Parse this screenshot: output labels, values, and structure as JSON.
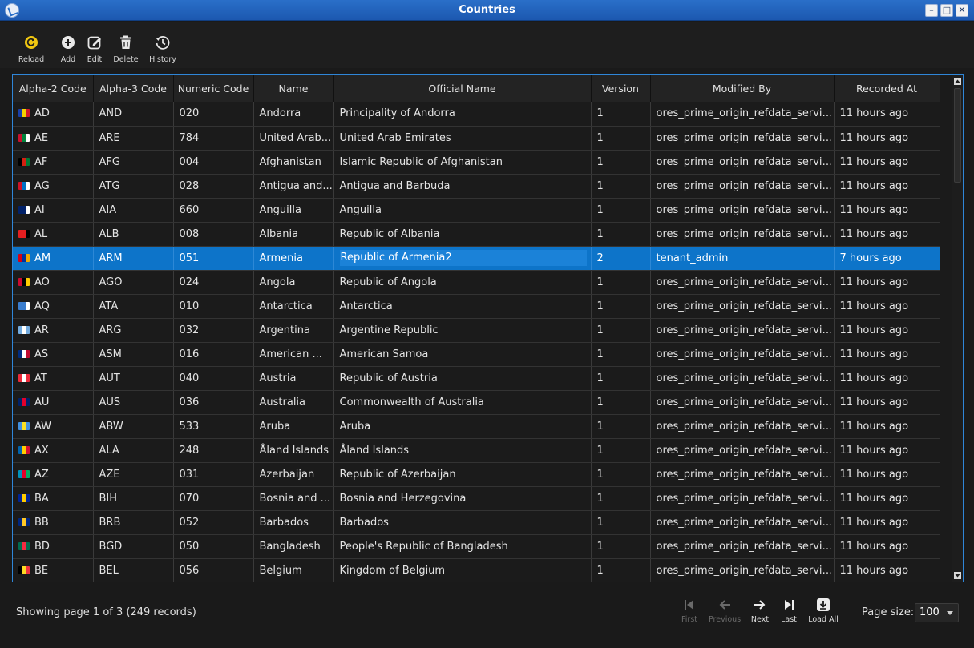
{
  "window": {
    "title": "Countries"
  },
  "toolbar": {
    "reload": "Reload",
    "add": "Add",
    "edit": "Edit",
    "delete": "Delete",
    "history": "History"
  },
  "table": {
    "columns": [
      "Alpha-2 Code",
      "Alpha-3 Code",
      "Numeric Code",
      "Name",
      "Official Name",
      "Version",
      "Modified By",
      "Recorded At"
    ],
    "rows": [
      {
        "a2": "AD",
        "a3": "AND",
        "num": "020",
        "name": "Andorra",
        "official": "Principality of Andorra",
        "ver": "1",
        "by": "ores_prime_origin_refdata_service",
        "at": "11 hours ago",
        "flag": [
          "#1a3fa8",
          "#f4d300",
          "#d11a2a"
        ]
      },
      {
        "a2": "AE",
        "a3": "ARE",
        "num": "784",
        "name": "United Arab...",
        "official": "United Arab Emirates",
        "ver": "1",
        "by": "ores_prime_origin_refdata_service",
        "at": "11 hours ago",
        "flag": [
          "#c8102e",
          "#00843d",
          "#ffffff"
        ]
      },
      {
        "a2": "AF",
        "a3": "AFG",
        "num": "004",
        "name": "Afghanistan",
        "official": "Islamic Republic of Afghanistan",
        "ver": "1",
        "by": "ores_prime_origin_refdata_service",
        "at": "11 hours ago",
        "flag": [
          "#000000",
          "#d32011",
          "#007a36"
        ]
      },
      {
        "a2": "AG",
        "a3": "ATG",
        "num": "028",
        "name": "Antigua and...",
        "official": "Antigua and Barbuda",
        "ver": "1",
        "by": "ores_prime_origin_refdata_service",
        "at": "11 hours ago",
        "flag": [
          "#ce1126",
          "#0072c6",
          "#ffffff"
        ]
      },
      {
        "a2": "AI",
        "a3": "AIA",
        "num": "660",
        "name": "Anguilla",
        "official": "Anguilla",
        "ver": "1",
        "by": "ores_prime_origin_refdata_service",
        "at": "11 hours ago",
        "flag": [
          "#012169",
          "#012169",
          "#ffffff"
        ]
      },
      {
        "a2": "AL",
        "a3": "ALB",
        "num": "008",
        "name": "Albania",
        "official": "Republic of Albania",
        "ver": "1",
        "by": "ores_prime_origin_refdata_service",
        "at": "11 hours ago",
        "flag": [
          "#e41e20",
          "#e41e20",
          "#000000"
        ]
      },
      {
        "a2": "AM",
        "a3": "ARM",
        "num": "051",
        "name": "Armenia",
        "official": "Republic of Armenia2",
        "ver": "2",
        "by": "tenant_admin",
        "at": "7 hours ago",
        "flag": [
          "#d90012",
          "#0033a0",
          "#f2a800"
        ],
        "selected": true
      },
      {
        "a2": "AO",
        "a3": "AGO",
        "num": "024",
        "name": "Angola",
        "official": "Republic of Angola",
        "ver": "1",
        "by": "ores_prime_origin_refdata_service",
        "at": "11 hours ago",
        "flag": [
          "#cc092f",
          "#000000",
          "#ffcb00"
        ]
      },
      {
        "a2": "AQ",
        "a3": "ATA",
        "num": "010",
        "name": "Antarctica",
        "official": "Antarctica",
        "ver": "1",
        "by": "ores_prime_origin_refdata_service",
        "at": "11 hours ago",
        "flag": [
          "#3a7dce",
          "#3a7dce",
          "#ffffff"
        ]
      },
      {
        "a2": "AR",
        "a3": "ARG",
        "num": "032",
        "name": "Argentina",
        "official": "Argentine Republic",
        "ver": "1",
        "by": "ores_prime_origin_refdata_service",
        "at": "11 hours ago",
        "flag": [
          "#74acdf",
          "#ffffff",
          "#74acdf"
        ]
      },
      {
        "a2": "AS",
        "a3": "ASM",
        "num": "016",
        "name": "American ...",
        "official": "American Samoa",
        "ver": "1",
        "by": "ores_prime_origin_refdata_service",
        "at": "11 hours ago",
        "flag": [
          "#002b7f",
          "#ffffff",
          "#bf0a30"
        ]
      },
      {
        "a2": "AT",
        "a3": "AUT",
        "num": "040",
        "name": "Austria",
        "official": "Republic of Austria",
        "ver": "1",
        "by": "ores_prime_origin_refdata_service",
        "at": "11 hours ago",
        "flag": [
          "#ed2939",
          "#ffffff",
          "#ed2939"
        ]
      },
      {
        "a2": "AU",
        "a3": "AUS",
        "num": "036",
        "name": "Australia",
        "official": "Commonwealth of Australia",
        "ver": "1",
        "by": "ores_prime_origin_refdata_service",
        "at": "11 hours ago",
        "flag": [
          "#012169",
          "#e4002b",
          "#012169"
        ]
      },
      {
        "a2": "AW",
        "a3": "ABW",
        "num": "533",
        "name": "Aruba",
        "official": "Aruba",
        "ver": "1",
        "by": "ores_prime_origin_refdata_service",
        "at": "11 hours ago",
        "flag": [
          "#418fde",
          "#fbe122",
          "#418fde"
        ]
      },
      {
        "a2": "AX",
        "a3": "ALA",
        "num": "248",
        "name": "Åland Islands",
        "official": "Åland Islands",
        "ver": "1",
        "by": "ores_prime_origin_refdata_service",
        "at": "11 hours ago",
        "flag": [
          "#0064ad",
          "#ffce00",
          "#d21034"
        ]
      },
      {
        "a2": "AZ",
        "a3": "AZE",
        "num": "031",
        "name": "Azerbaijan",
        "official": "Republic of Azerbaijan",
        "ver": "1",
        "by": "ores_prime_origin_refdata_service",
        "at": "11 hours ago",
        "flag": [
          "#0092bc",
          "#e4002b",
          "#00af66"
        ]
      },
      {
        "a2": "BA",
        "a3": "BIH",
        "num": "070",
        "name": "Bosnia and ...",
        "official": "Bosnia and Herzegovina",
        "ver": "1",
        "by": "ores_prime_origin_refdata_service",
        "at": "11 hours ago",
        "flag": [
          "#002395",
          "#fecb00",
          "#002395"
        ]
      },
      {
        "a2": "BB",
        "a3": "BRB",
        "num": "052",
        "name": "Barbados",
        "official": "Barbados",
        "ver": "1",
        "by": "ores_prime_origin_refdata_service",
        "at": "11 hours ago",
        "flag": [
          "#00267f",
          "#ffc726",
          "#00267f"
        ]
      },
      {
        "a2": "BD",
        "a3": "BGD",
        "num": "050",
        "name": "Bangladesh",
        "official": "People's Republic of Bangladesh",
        "ver": "1",
        "by": "ores_prime_origin_refdata_service",
        "at": "11 hours ago",
        "flag": [
          "#006a4e",
          "#f42a41",
          "#006a4e"
        ]
      },
      {
        "a2": "BE",
        "a3": "BEL",
        "num": "056",
        "name": "Belgium",
        "official": "Kingdom of Belgium",
        "ver": "1",
        "by": "ores_prime_origin_refdata_service",
        "at": "11 hours ago",
        "flag": [
          "#000000",
          "#fdda24",
          "#ef3340"
        ]
      }
    ]
  },
  "footer": {
    "status": "Showing page 1 of 3 (249 records)",
    "first": "First",
    "previous": "Previous",
    "next": "Next",
    "last": "Last",
    "load_all": "Load All",
    "page_size_label": "Page size:",
    "page_size": "100"
  },
  "colors": {
    "accent": "#0d74c9",
    "titlebar": "#2a6fc9",
    "reload_icon": "#f2c811"
  }
}
